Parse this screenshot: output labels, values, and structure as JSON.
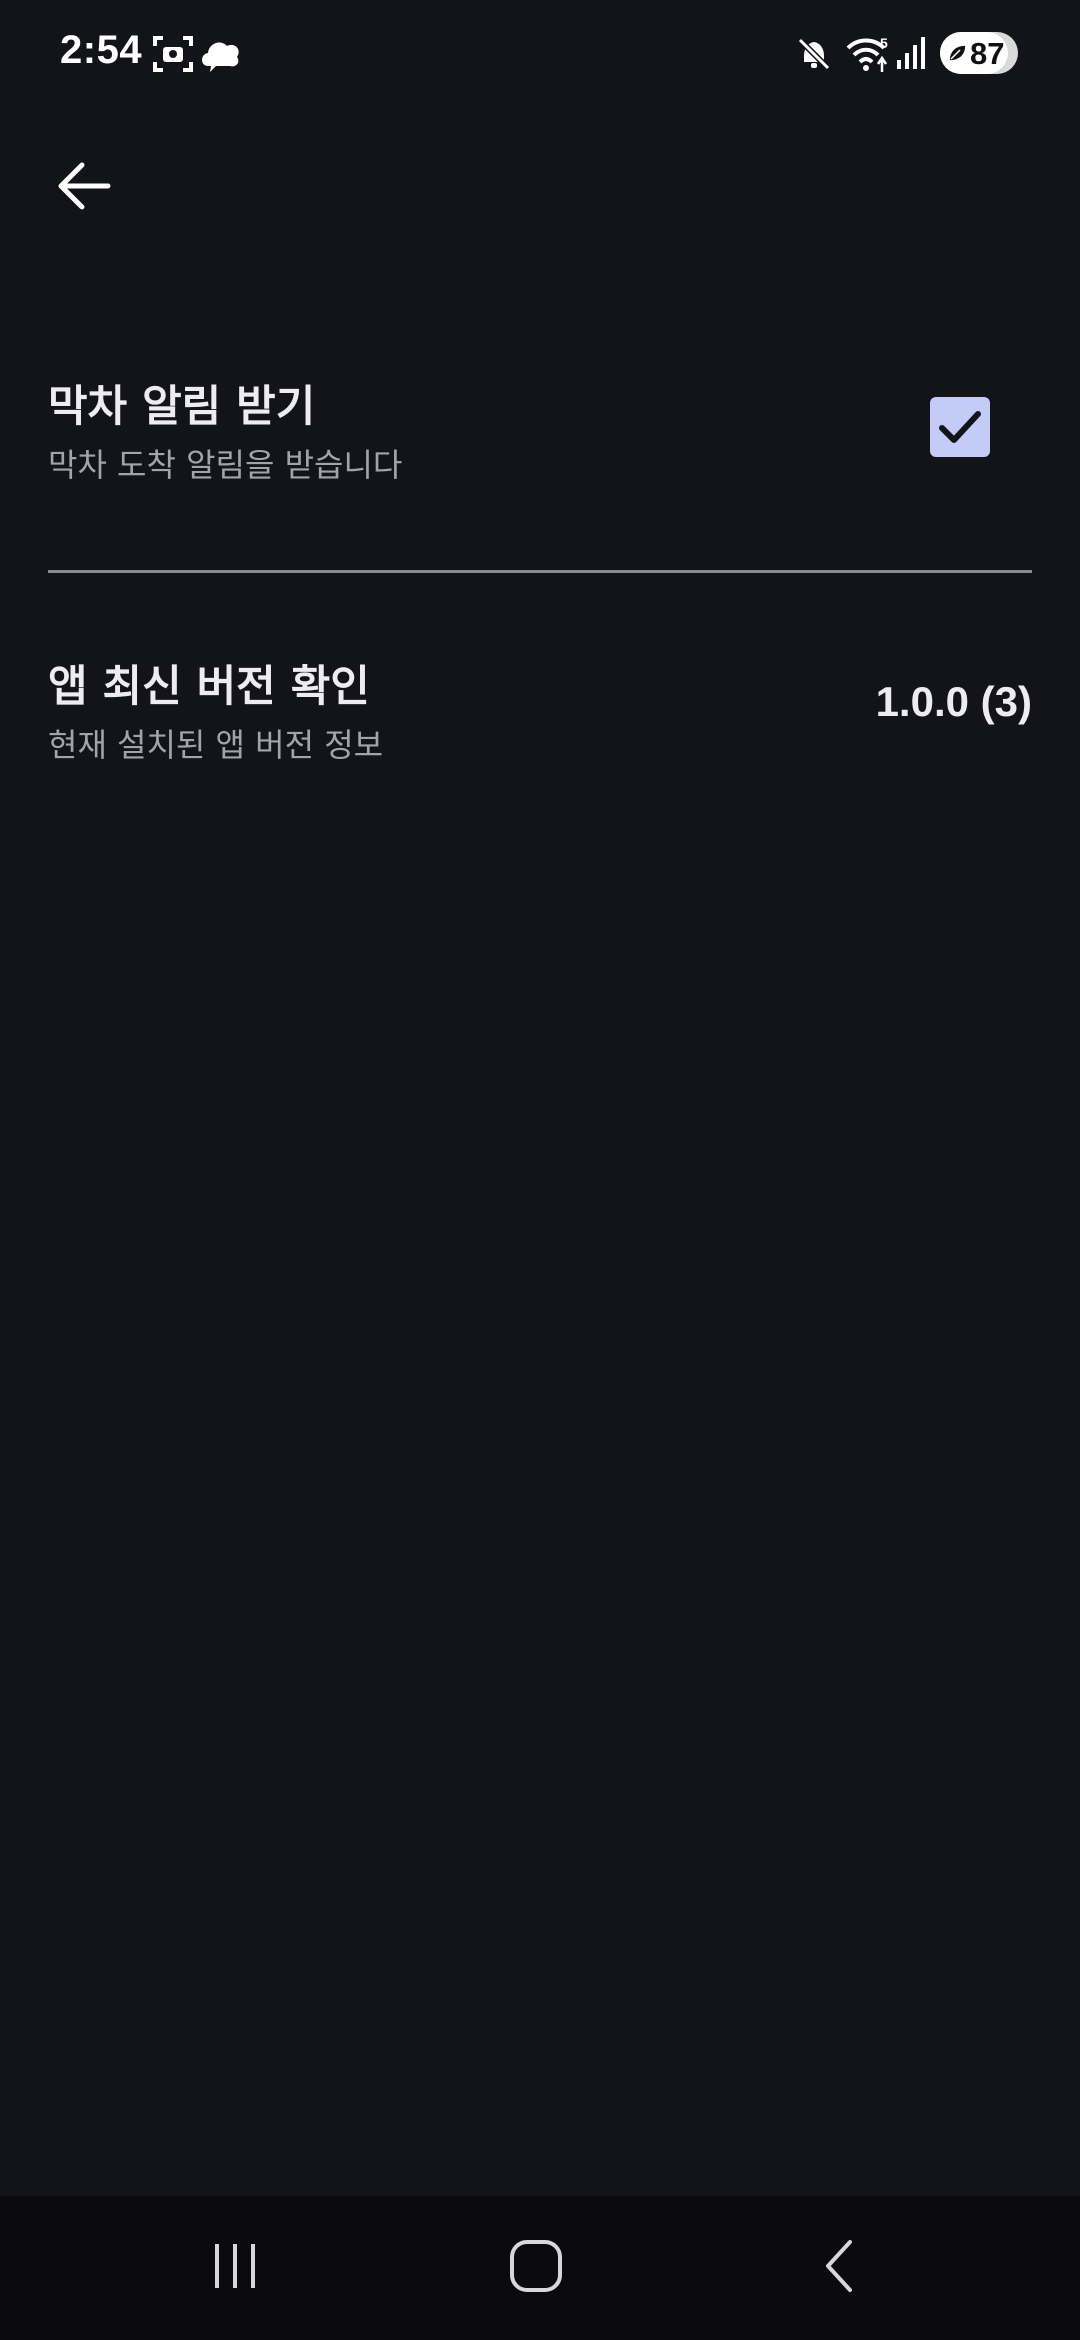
{
  "status_bar": {
    "time": "2:54",
    "battery": "87",
    "battery_level_percent": 87,
    "network_label": "5",
    "icons": [
      "screenshot-icon",
      "cloud-icon",
      "mute-icon",
      "wifi-icon",
      "signal-icon",
      "battery-icon"
    ]
  },
  "header": {
    "back_icon": "arrow-left-icon"
  },
  "settings": {
    "notification": {
      "title": "막차 알림 받기",
      "subtitle": "막차 도착 알림을 받습니다",
      "checked": true
    },
    "version": {
      "title": "앱 최신 버전 확인",
      "subtitle": "현재 설치된 앱 버전 정보",
      "value": "1.0.0 (3)"
    }
  },
  "nav_bar": {
    "icons": [
      "recent-apps-icon",
      "home-icon",
      "back-icon"
    ]
  },
  "colors": {
    "background": "#13141a",
    "checkbox": "#c3cbf7",
    "divider": "#8a8b91",
    "subtitle": "#a3a4ab"
  }
}
